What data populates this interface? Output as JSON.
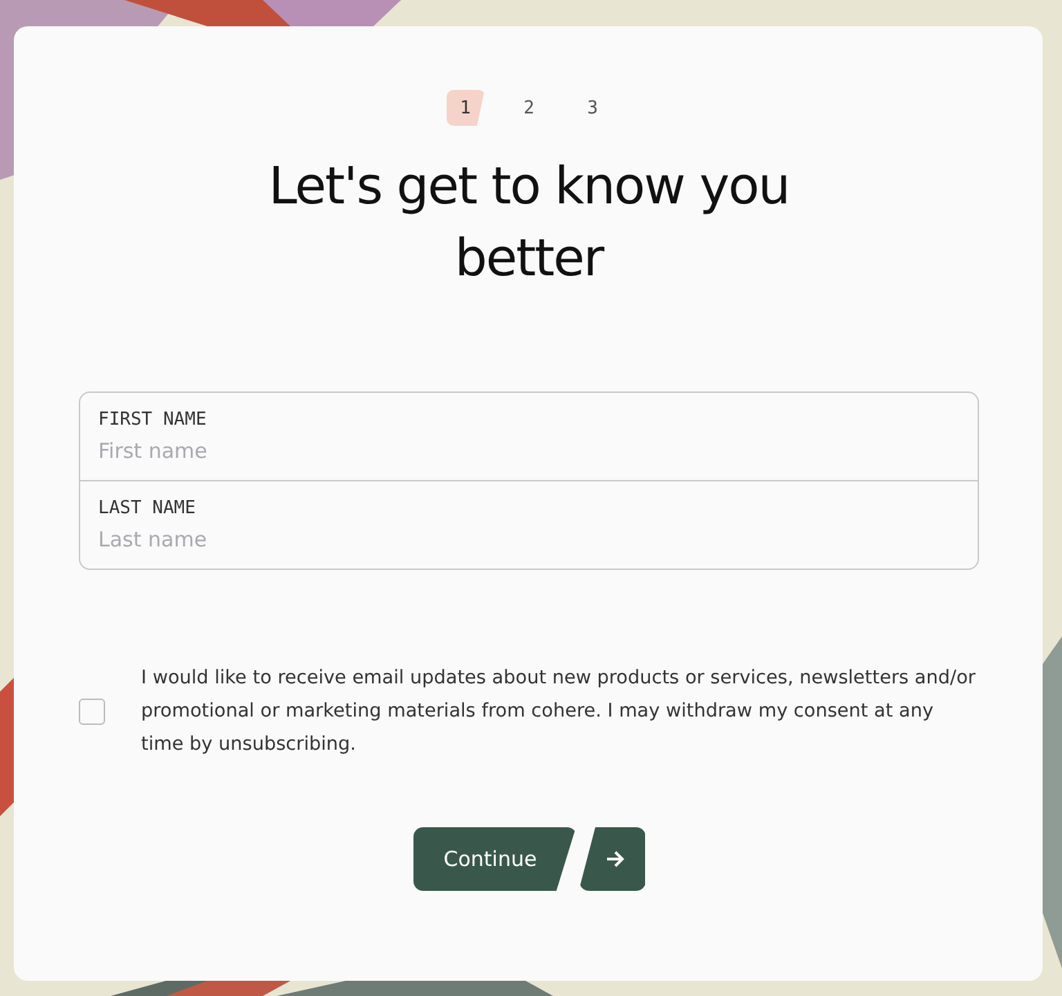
{
  "steps": [
    {
      "label": "1",
      "selected": true
    },
    {
      "label": "2",
      "selected": false
    },
    {
      "label": "3",
      "selected": false
    }
  ],
  "title": "Let's get to know you better",
  "fields": [
    {
      "label": "FIRST NAME",
      "placeholder": "First name"
    },
    {
      "label": "LAST NAME",
      "placeholder": "Last name"
    }
  ],
  "consent": {
    "checked": false,
    "text": "I would like to receive email updates about new products or services, newsletters and/or promotional or marketing materials from cohere. I may withdraw my consent at any time by unsubscribing."
  },
  "continue_button": {
    "label": "Continue"
  }
}
